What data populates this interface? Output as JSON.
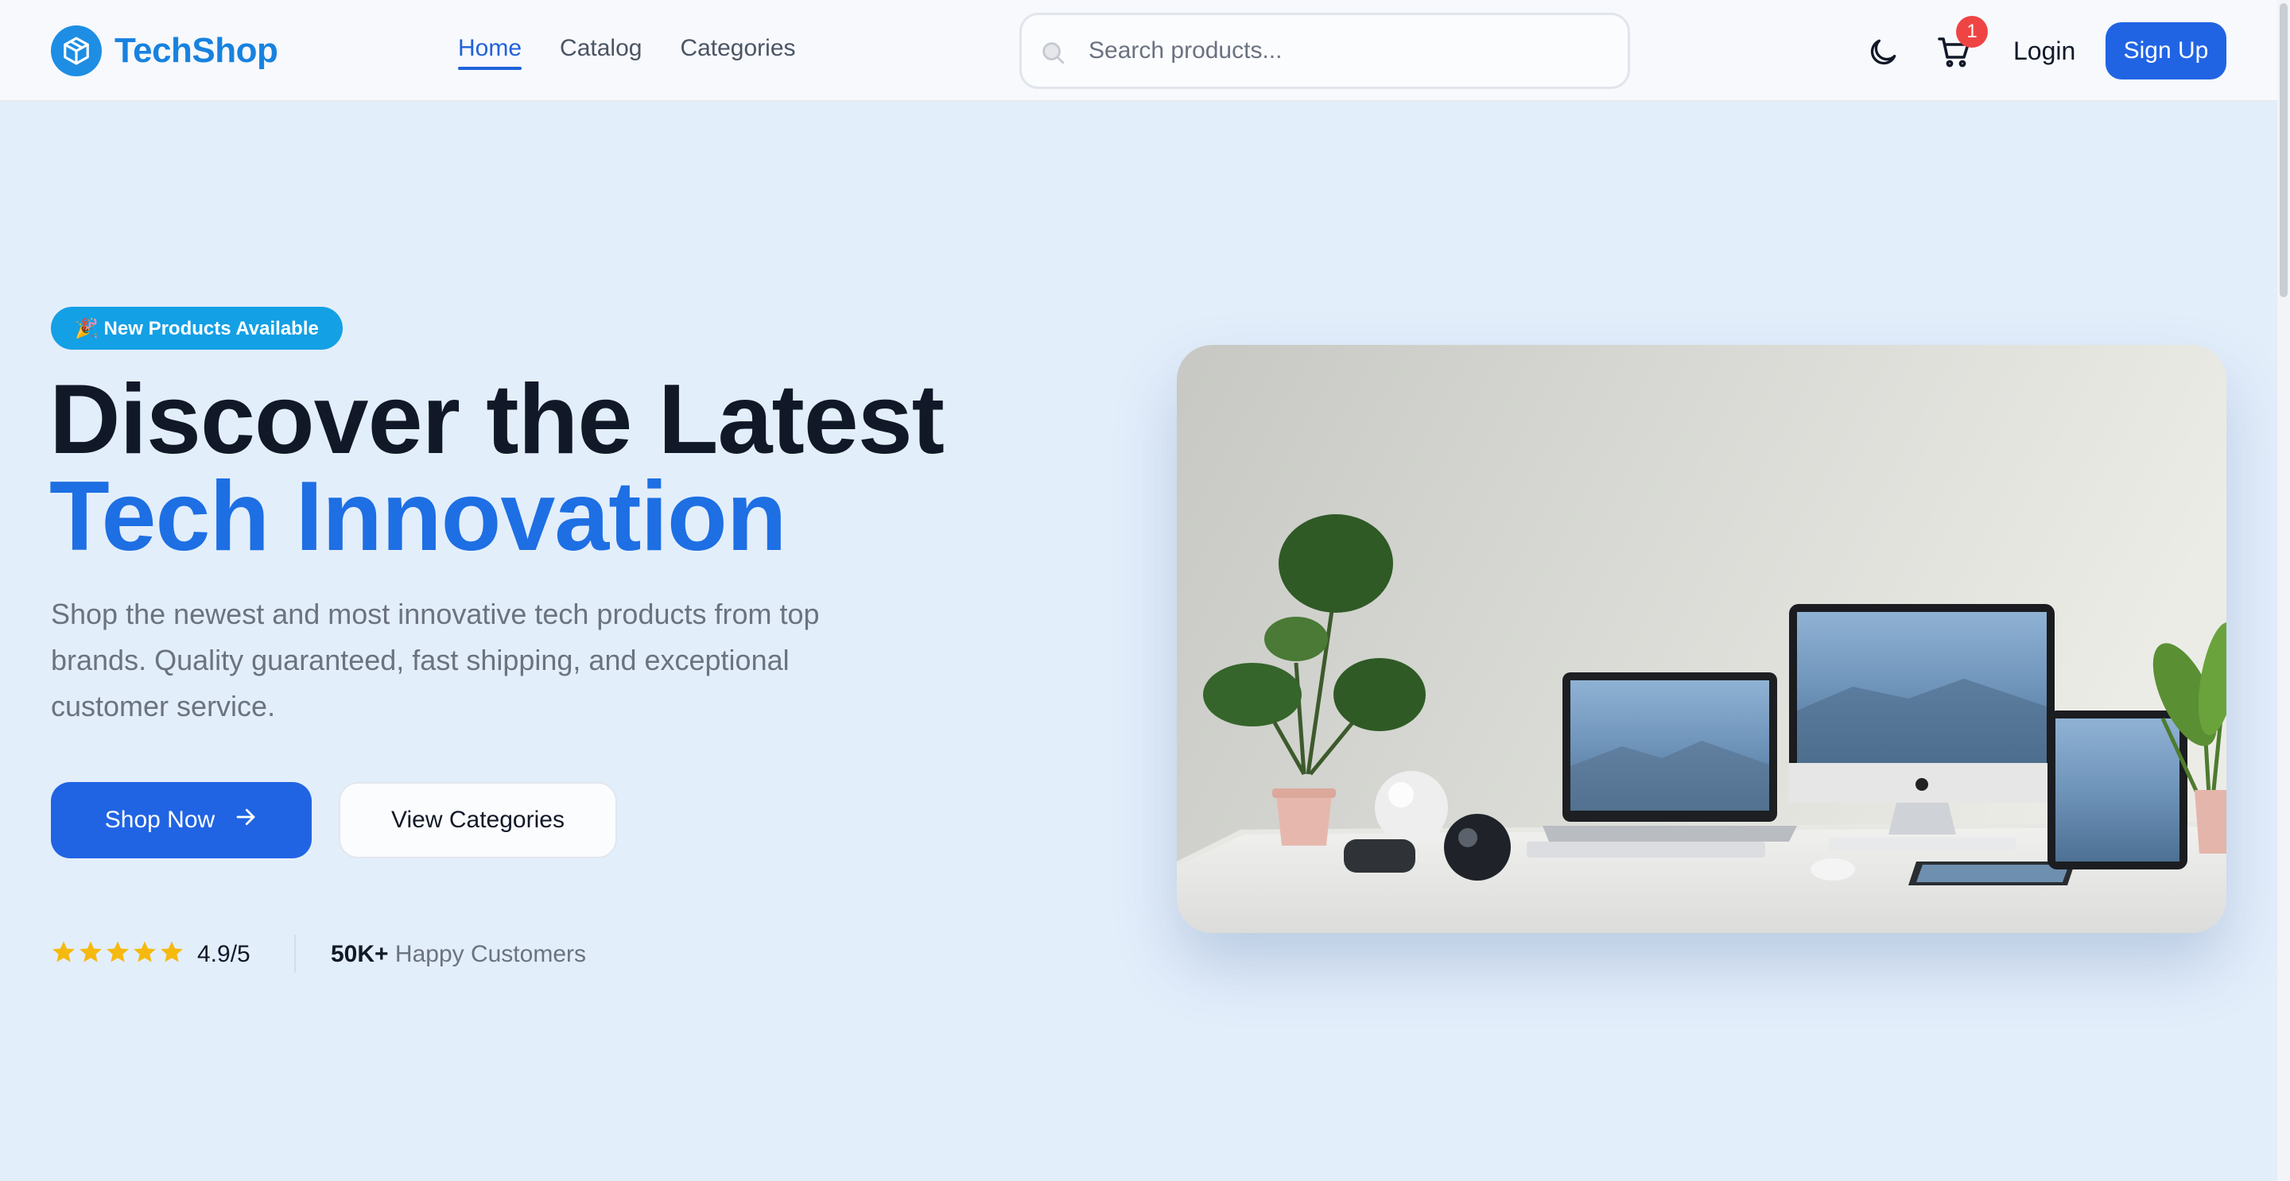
{
  "brand": {
    "name": "TechShop",
    "logo_icon": "package-icon",
    "color": "#1882df"
  },
  "nav": {
    "links": [
      {
        "label": "Home",
        "active": true
      },
      {
        "label": "Catalog",
        "active": false
      },
      {
        "label": "Categories",
        "active": false
      }
    ]
  },
  "search": {
    "placeholder": "Search products...",
    "value": ""
  },
  "header_actions": {
    "theme_icon": "moon-icon",
    "cart_icon": "cart-icon",
    "cart_count": "1",
    "login_label": "Login",
    "signup_label": "Sign Up"
  },
  "hero": {
    "badge": "🎉 New Products Available",
    "title_line1": "Discover the Latest",
    "title_line2": "Tech Innovation",
    "description": "Shop the newest and most innovative tech products from top brands. Quality guaranteed, fast shipping, and exceptional customer service.",
    "primary_button": "Shop Now",
    "secondary_button": "View Categories",
    "rating": {
      "stars": 5,
      "text": "4.9/5"
    },
    "customers": {
      "count": "50K+",
      "label": "Happy Customers"
    }
  },
  "colors": {
    "accent": "#2064e4",
    "title_blue": "#1d6fe3",
    "badge": "#14a0e5",
    "cart_badge": "#ef4444",
    "star": "#f5b90f"
  }
}
